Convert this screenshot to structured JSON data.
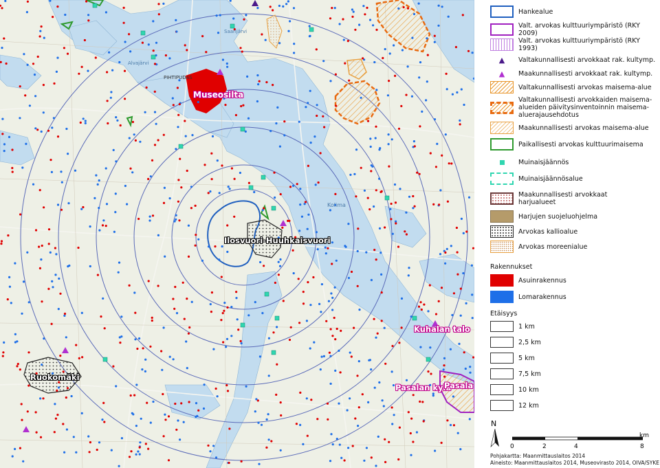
{
  "map": {
    "places": [
      {
        "id": "museosilta",
        "label": "Museosilta",
        "style": "magenta"
      },
      {
        "id": "ilosvuori",
        "label": "Ilosvuori-Huuhkaisvuori",
        "style": "white"
      },
      {
        "id": "ruokomaki",
        "label": "Ruokomäki",
        "style": "white"
      },
      {
        "id": "kuhalan",
        "label": "Kuhalan talo",
        "style": "magenta"
      },
      {
        "id": "pasalan-kyla",
        "label": "Pasalan kylä",
        "style": "magenta"
      },
      {
        "id": "pasala",
        "label": "Pasala",
        "style": "magenta"
      }
    ],
    "minor_labels": [
      "PIHTIPUDAS",
      "Kolima",
      "Alvajärvi",
      "Saarijärvi"
    ]
  },
  "colors": {
    "hankealue": "#1f5fbf",
    "rky2009": "#a020c0",
    "rky1993": "#c080e0",
    "valtakunnallinen_maisema": "#e8952a",
    "maakunnallinen_maisema": "#e8a040",
    "paikallinen": "#2e9a2e",
    "muinais": "#2fd6b0",
    "asuin": "#e00000",
    "loma": "#1e6fe8",
    "harju": "#b59b6a",
    "water": "#c2dcef",
    "land": "#eef0e6",
    "ring": "#5a6ab8"
  },
  "legend": {
    "items": [
      {
        "key": "hankealue",
        "label": "Hankealue"
      },
      {
        "key": "rky2009",
        "label": "Valt. arvokas kulttuuriympäristö (RKY 2009)"
      },
      {
        "key": "rky1993",
        "label": "Valt. arvokas kulttuuriympäristö (RKY 1993)"
      },
      {
        "key": "valt_rak",
        "label": "Valtakunnallisesti arvokkaat rak. kultymp."
      },
      {
        "key": "maak_rak",
        "label": "Maakunnallisesti arvokkaat rak. kultymp."
      },
      {
        "key": "valt_maisema",
        "label": "Valtakunnallisesti arvokas maisema-alue"
      },
      {
        "key": "valt_maisema_ehd",
        "label": "Valtakunnallisesti arvokkaiden maisema-alueiden päivitysinventoinnin maisema-aluerajausehdotus"
      },
      {
        "key": "maak_maisema",
        "label": "Maakunnallisesti arvokas maisema-alue"
      },
      {
        "key": "paik",
        "label": "Paikallisesti arvokas kulttuurimaisema"
      },
      {
        "key": "muinais",
        "label": "Muinaisjäännös"
      },
      {
        "key": "muinaisalue",
        "label": "Muinaisjäännösalue"
      },
      {
        "key": "harjualue",
        "label": "Maakunnallisesti arvokkaat harjualueet"
      },
      {
        "key": "harjuohjelma",
        "label": "Harjujen suojeluohjelma"
      },
      {
        "key": "kallio",
        "label": "Arvokas kallioalue"
      },
      {
        "key": "moreeni",
        "label": "Arvokas moreenialue"
      }
    ],
    "buildings_heading": "Rakennukset",
    "buildings": [
      {
        "key": "asuin",
        "label": "Asuinrakennus"
      },
      {
        "key": "loma",
        "label": "Lomarakennus"
      }
    ],
    "distance_heading": "Etäisyys",
    "distances": [
      "1 km",
      "2,5 km",
      "5 km",
      "7,5 km",
      "10 km",
      "12 km"
    ],
    "north": "N",
    "scale_ticks": [
      "0",
      "2",
      "4",
      "8"
    ],
    "scale_unit": "km",
    "credit_1": "Pohjakartta: Maanmittauslaitos 2014",
    "credit_2": "Aineisto: Maanmittauslaitos 2014, Museovirasto 2014, OIVA/SYKE 2014"
  }
}
